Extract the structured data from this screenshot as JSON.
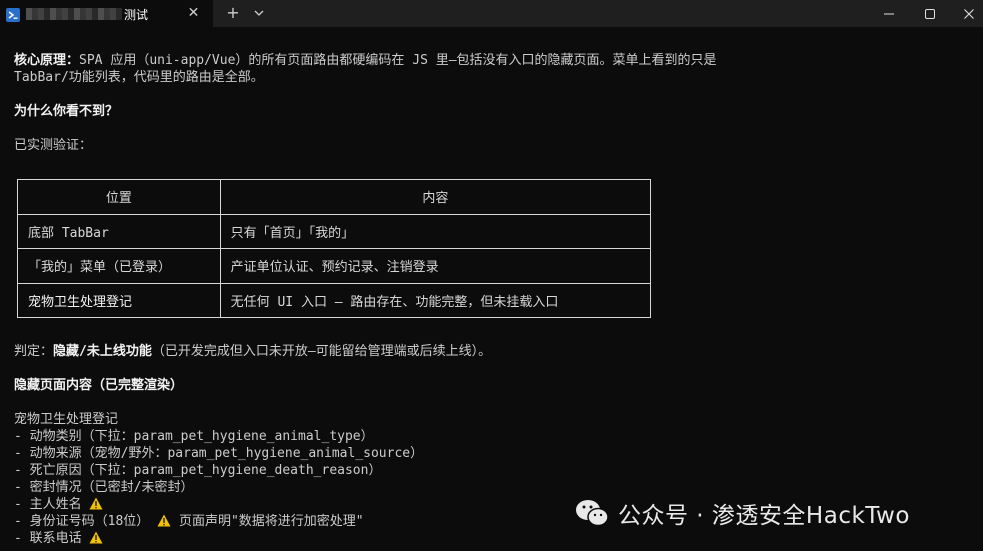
{
  "window": {
    "tab_title": "测试",
    "tab_close_glyph": "✕",
    "new_tab_glyph": "+"
  },
  "content": {
    "line1_label": "核心原理：",
    "line1_text": "SPA 应用（uni-app/Vue）的所有页面路由都硬编码在 JS 里—包括没有入口的隐藏页面。菜单上看到的只是",
    "line2": "TabBar/功能列表，代码里的路由是全部。",
    "heading_why": "为什么你看不到？",
    "verified": "已实测验证：",
    "table": {
      "headers": [
        "位置",
        "内容"
      ],
      "rows": [
        [
          "底部 TabBar",
          "只有「首页」「我的」"
        ],
        [
          "「我的」菜单（已登录）",
          "产证单位认证、预约记录、注销登录"
        ],
        [
          "宠物卫生处理登记",
          "无任何 UI 入口 — 路由存在、功能完整，但未挂载入口"
        ]
      ]
    },
    "verdict_label": "判定：",
    "verdict_bold": "隐藏/未上线功能",
    "verdict_rest": "（已开发完成但入口未开放—可能留给管理端或后续上线）。",
    "hidden_heading": "隐藏页面内容（已完整渲染）",
    "page_name": "宠物卫生处理登记",
    "fields": [
      "- 动物类别（下拉：param_pet_hygiene_animal_type）",
      "- 动物来源（宠物/野外：param_pet_hygiene_animal_source）",
      "- 死亡原因（下拉：param_pet_hygiene_death_reason）",
      "- 密封情况（已密封/未密封）",
      "- 主人姓名 ",
      "- 身份证号码（18位）",
      "- 联系电话 "
    ],
    "id_note": " 页面声明\"数据将进行加密处理\""
  },
  "watermark": {
    "text": "公众号 · 渗透安全HackTwo"
  },
  "colors": {
    "terminal_bg": "#0c0c0c",
    "titlebar_bg": "#1f1f1f",
    "text": "#cccccc",
    "warning": "#f2c200"
  },
  "icons": {
    "tab": "powershell-icon",
    "warning": "warning-icon",
    "watermark": "wechat-icon"
  }
}
